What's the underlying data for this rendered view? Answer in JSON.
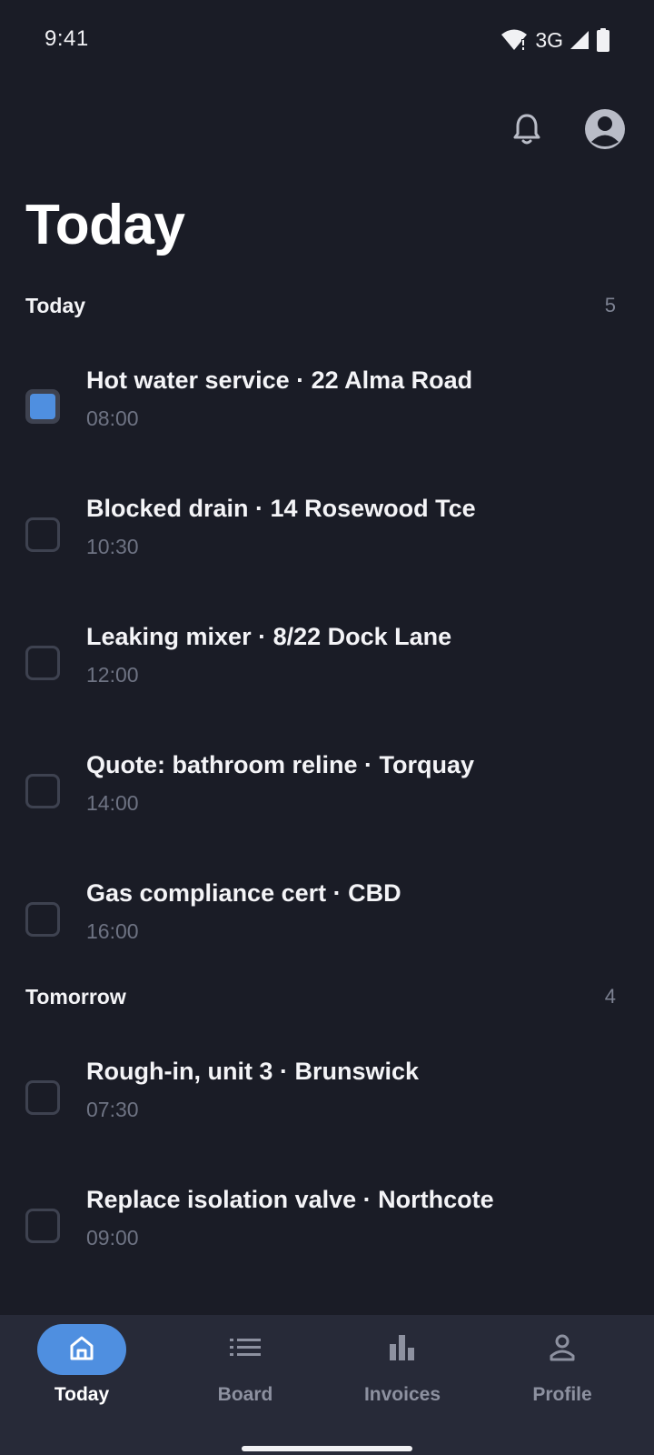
{
  "status_bar": {
    "time": "9:41",
    "network": "3G",
    "icons": [
      "wifi-icon",
      "signal-icon",
      "battery-icon"
    ]
  },
  "header": {
    "title": "Today",
    "actions": [
      "bell-icon",
      "account-circle-icon"
    ]
  },
  "sections": [
    {
      "title": "Today",
      "count": "5",
      "tasks": [
        {
          "title": "Hot water service · 22 Alma Road",
          "time": "08:00",
          "checked": true
        },
        {
          "title": "Blocked drain · 14 Rosewood Tce",
          "time": "10:30",
          "checked": false
        },
        {
          "title": "Leaking mixer · 8/22 Dock Lane",
          "time": "12:00",
          "checked": false
        },
        {
          "title": "Quote: bathroom reline · Torquay",
          "time": "14:00",
          "checked": false
        },
        {
          "title": "Gas compliance cert · CBD",
          "time": "16:00",
          "checked": false
        }
      ]
    },
    {
      "title": "Tomorrow",
      "count": "4",
      "tasks": [
        {
          "title": "Rough-in, unit 3 · Brunswick",
          "time": "07:30",
          "checked": false
        },
        {
          "title": "Replace isolation valve · Northcote",
          "time": "09:00",
          "checked": false
        }
      ]
    }
  ],
  "bottom_nav": {
    "items": [
      {
        "label": "Today",
        "icon": "home-icon",
        "active": true
      },
      {
        "label": "Board",
        "icon": "list-icon",
        "active": false
      },
      {
        "label": "Invoices",
        "icon": "bar-chart-icon",
        "active": false
      },
      {
        "label": "Profile",
        "icon": "person-icon",
        "active": false
      }
    ]
  },
  "colors": {
    "background": "#1a1c26",
    "accent": "#4f8fe0",
    "nav_background": "#272a38",
    "muted_text": "#6e7383"
  }
}
